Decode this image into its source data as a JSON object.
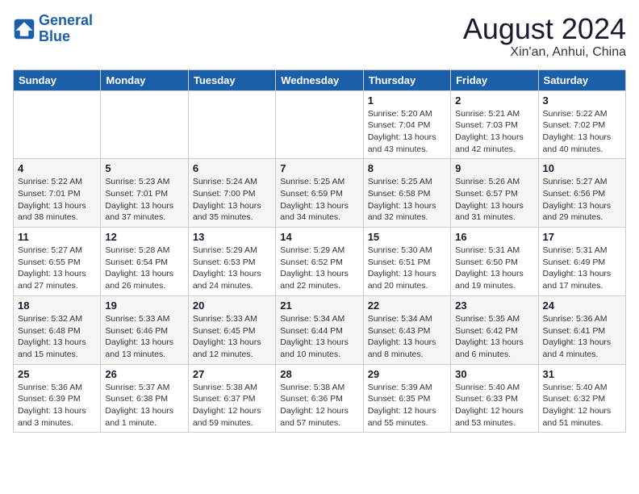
{
  "header": {
    "logo_line1": "General",
    "logo_line2": "Blue",
    "month_year": "August 2024",
    "location": "Xin'an, Anhui, China"
  },
  "days_of_week": [
    "Sunday",
    "Monday",
    "Tuesday",
    "Wednesday",
    "Thursday",
    "Friday",
    "Saturday"
  ],
  "weeks": [
    [
      {
        "day": "",
        "info": ""
      },
      {
        "day": "",
        "info": ""
      },
      {
        "day": "",
        "info": ""
      },
      {
        "day": "",
        "info": ""
      },
      {
        "day": "1",
        "info": "Sunrise: 5:20 AM\nSunset: 7:04 PM\nDaylight: 13 hours\nand 43 minutes."
      },
      {
        "day": "2",
        "info": "Sunrise: 5:21 AM\nSunset: 7:03 PM\nDaylight: 13 hours\nand 42 minutes."
      },
      {
        "day": "3",
        "info": "Sunrise: 5:22 AM\nSunset: 7:02 PM\nDaylight: 13 hours\nand 40 minutes."
      }
    ],
    [
      {
        "day": "4",
        "info": "Sunrise: 5:22 AM\nSunset: 7:01 PM\nDaylight: 13 hours\nand 38 minutes."
      },
      {
        "day": "5",
        "info": "Sunrise: 5:23 AM\nSunset: 7:01 PM\nDaylight: 13 hours\nand 37 minutes."
      },
      {
        "day": "6",
        "info": "Sunrise: 5:24 AM\nSunset: 7:00 PM\nDaylight: 13 hours\nand 35 minutes."
      },
      {
        "day": "7",
        "info": "Sunrise: 5:25 AM\nSunset: 6:59 PM\nDaylight: 13 hours\nand 34 minutes."
      },
      {
        "day": "8",
        "info": "Sunrise: 5:25 AM\nSunset: 6:58 PM\nDaylight: 13 hours\nand 32 minutes."
      },
      {
        "day": "9",
        "info": "Sunrise: 5:26 AM\nSunset: 6:57 PM\nDaylight: 13 hours\nand 31 minutes."
      },
      {
        "day": "10",
        "info": "Sunrise: 5:27 AM\nSunset: 6:56 PM\nDaylight: 13 hours\nand 29 minutes."
      }
    ],
    [
      {
        "day": "11",
        "info": "Sunrise: 5:27 AM\nSunset: 6:55 PM\nDaylight: 13 hours\nand 27 minutes."
      },
      {
        "day": "12",
        "info": "Sunrise: 5:28 AM\nSunset: 6:54 PM\nDaylight: 13 hours\nand 26 minutes."
      },
      {
        "day": "13",
        "info": "Sunrise: 5:29 AM\nSunset: 6:53 PM\nDaylight: 13 hours\nand 24 minutes."
      },
      {
        "day": "14",
        "info": "Sunrise: 5:29 AM\nSunset: 6:52 PM\nDaylight: 13 hours\nand 22 minutes."
      },
      {
        "day": "15",
        "info": "Sunrise: 5:30 AM\nSunset: 6:51 PM\nDaylight: 13 hours\nand 20 minutes."
      },
      {
        "day": "16",
        "info": "Sunrise: 5:31 AM\nSunset: 6:50 PM\nDaylight: 13 hours\nand 19 minutes."
      },
      {
        "day": "17",
        "info": "Sunrise: 5:31 AM\nSunset: 6:49 PM\nDaylight: 13 hours\nand 17 minutes."
      }
    ],
    [
      {
        "day": "18",
        "info": "Sunrise: 5:32 AM\nSunset: 6:48 PM\nDaylight: 13 hours\nand 15 minutes."
      },
      {
        "day": "19",
        "info": "Sunrise: 5:33 AM\nSunset: 6:46 PM\nDaylight: 13 hours\nand 13 minutes."
      },
      {
        "day": "20",
        "info": "Sunrise: 5:33 AM\nSunset: 6:45 PM\nDaylight: 13 hours\nand 12 minutes."
      },
      {
        "day": "21",
        "info": "Sunrise: 5:34 AM\nSunset: 6:44 PM\nDaylight: 13 hours\nand 10 minutes."
      },
      {
        "day": "22",
        "info": "Sunrise: 5:34 AM\nSunset: 6:43 PM\nDaylight: 13 hours\nand 8 minutes."
      },
      {
        "day": "23",
        "info": "Sunrise: 5:35 AM\nSunset: 6:42 PM\nDaylight: 13 hours\nand 6 minutes."
      },
      {
        "day": "24",
        "info": "Sunrise: 5:36 AM\nSunset: 6:41 PM\nDaylight: 13 hours\nand 4 minutes."
      }
    ],
    [
      {
        "day": "25",
        "info": "Sunrise: 5:36 AM\nSunset: 6:39 PM\nDaylight: 13 hours\nand 3 minutes."
      },
      {
        "day": "26",
        "info": "Sunrise: 5:37 AM\nSunset: 6:38 PM\nDaylight: 13 hours\nand 1 minute."
      },
      {
        "day": "27",
        "info": "Sunrise: 5:38 AM\nSunset: 6:37 PM\nDaylight: 12 hours\nand 59 minutes."
      },
      {
        "day": "28",
        "info": "Sunrise: 5:38 AM\nSunset: 6:36 PM\nDaylight: 12 hours\nand 57 minutes."
      },
      {
        "day": "29",
        "info": "Sunrise: 5:39 AM\nSunset: 6:35 PM\nDaylight: 12 hours\nand 55 minutes."
      },
      {
        "day": "30",
        "info": "Sunrise: 5:40 AM\nSunset: 6:33 PM\nDaylight: 12 hours\nand 53 minutes."
      },
      {
        "day": "31",
        "info": "Sunrise: 5:40 AM\nSunset: 6:32 PM\nDaylight: 12 hours\nand 51 minutes."
      }
    ]
  ]
}
